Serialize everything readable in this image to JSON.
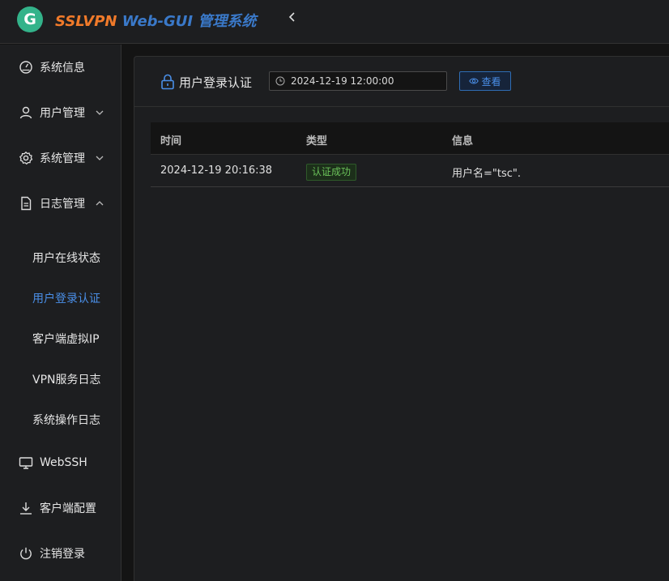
{
  "header": {
    "brand_part1": "SSLVPN",
    "brand_part2": "Web-GUI 管理系统",
    "logo_letter": "G",
    "collapse_icon": "chevron-left-icon"
  },
  "sidebar": {
    "items": [
      {
        "label": "系统信息",
        "icon": "dashboard-icon"
      },
      {
        "label": "用户管理",
        "icon": "user-icon",
        "expanded": false
      },
      {
        "label": "系统管理",
        "icon": "gear-icon",
        "expanded": false
      },
      {
        "label": "日志管理",
        "icon": "document-icon",
        "expanded": true
      },
      {
        "label": "WebSSH",
        "icon": "monitor-icon"
      },
      {
        "label": "客户端配置",
        "icon": "download-icon"
      },
      {
        "label": "注销登录",
        "icon": "power-icon"
      }
    ],
    "log_subitems": [
      {
        "label": "用户在线状态",
        "active": false
      },
      {
        "label": "用户登录认证",
        "active": true
      },
      {
        "label": "客户端虚拟IP",
        "active": false
      },
      {
        "label": "VPN服务日志",
        "active": false
      },
      {
        "label": "系统操作日志",
        "active": false
      }
    ]
  },
  "main": {
    "title": "用户登录认证",
    "title_icon": "lock-icon",
    "date_value": "2024-12-19 12:00:00",
    "view_button": "查看",
    "table": {
      "columns": [
        "时间",
        "类型",
        "信息"
      ],
      "rows": [
        {
          "time": "2024-12-19 20:16:38",
          "type": "认证成功",
          "info": "用户名=\"tsc\"."
        }
      ]
    }
  },
  "colors": {
    "accent": "#4a8fe8",
    "brand_orange": "#f07a2a",
    "brand_blue": "#3a79c9",
    "logo_green": "#33b38a",
    "success": "#6bc25a"
  }
}
